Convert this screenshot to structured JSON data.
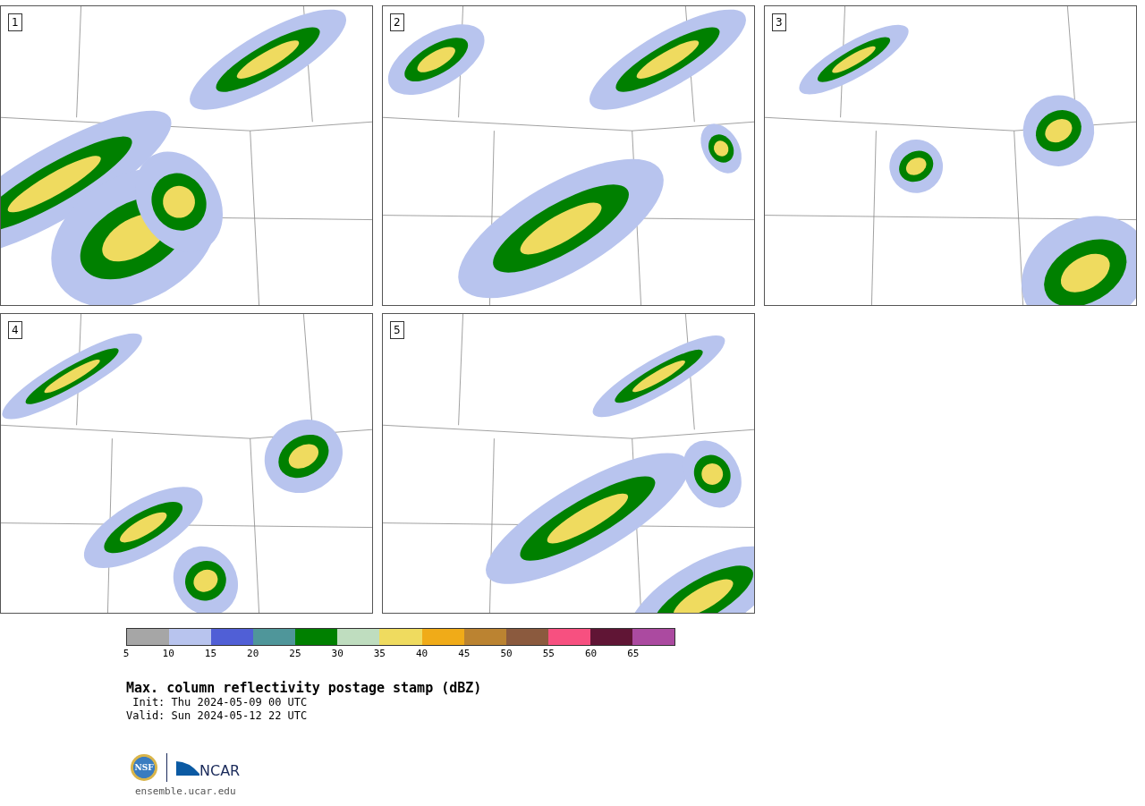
{
  "panels": [
    {
      "number": "1"
    },
    {
      "number": "2"
    },
    {
      "number": "3"
    },
    {
      "number": "4"
    },
    {
      "number": "5"
    }
  ],
  "colorbar": {
    "bins": [
      {
        "color": "#a6a6a6"
      },
      {
        "color": "#b8c4ee"
      },
      {
        "color": "#505fd6"
      },
      {
        "color": "#4f969a"
      },
      {
        "color": "#008000"
      },
      {
        "color": "#bfddbf"
      },
      {
        "color": "#efdb5f"
      },
      {
        "color": "#f0ab18"
      },
      {
        "color": "#bb8331"
      },
      {
        "color": "#8b5a3e"
      },
      {
        "color": "#f75080"
      },
      {
        "color": "#601535"
      },
      {
        "color": "#ab4aa0"
      }
    ],
    "ticks": [
      "5",
      "10",
      "15",
      "20",
      "25",
      "30",
      "35",
      "40",
      "45",
      "50",
      "55",
      "60",
      "65"
    ]
  },
  "title": "Max. column reflectivity postage stamp (dBZ)",
  "init": " Init: Thu 2024-05-09 00 UTC",
  "valid": "Valid: Sun 2024-05-12 22 UTC",
  "logos": {
    "left": "NSF",
    "right": "NCAR"
  },
  "url": "ensemble.ucar.edu"
}
